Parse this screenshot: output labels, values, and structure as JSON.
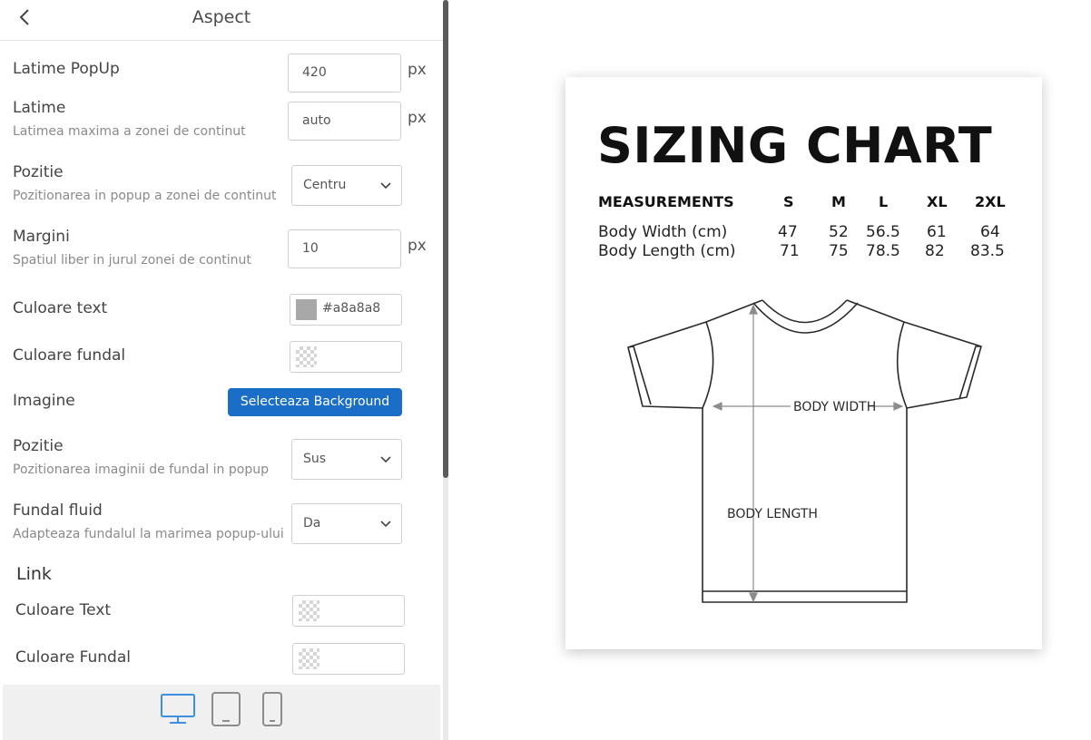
{
  "panel": {
    "title": "Aspect",
    "back_icon": "chevron-left-icon",
    "fields": {
      "popup_width": {
        "label": "Latime PopUp",
        "value": "420",
        "unit": "px"
      },
      "width": {
        "label": "Latime",
        "sublabel": "Latimea maxima a zonei de continut",
        "value": "auto",
        "unit": "px"
      },
      "position": {
        "label": "Pozitie",
        "sublabel": "Pozitionarea in popup a zonei de continut",
        "value": "Centru"
      },
      "margins": {
        "label": "Margini",
        "sublabel": "Spatiul liber in jurul zonei de continut",
        "value": "10",
        "unit": "px"
      },
      "text_color": {
        "label": "Culoare text",
        "value": "#a8a8a8"
      },
      "bg_color": {
        "label": "Culoare fundal"
      },
      "image": {
        "label": "Imagine",
        "button": "Selecteaza Background"
      },
      "image_position": {
        "label": "Pozitie",
        "sublabel": "Pozitionarea imaginii de fundal in popup",
        "value": "Sus"
      },
      "fluid_bg": {
        "label": "Fundal fluid",
        "sublabel": "Adapteaza fundalul la marimea popup-ului",
        "value": "Da"
      }
    },
    "link_section": {
      "title": "Link",
      "text_color": {
        "label": "Culoare Text"
      },
      "bg_color": {
        "label": "Culoare Fundal"
      }
    },
    "devices": [
      "desktop-icon",
      "tablet-icon",
      "mobile-icon"
    ],
    "active_device": "desktop",
    "accent_color": "#1a6ec8"
  },
  "preview": {
    "title": "SIZING CHART",
    "table": {
      "header": [
        "MEASUREMENTS",
        "S",
        "M",
        "L",
        "XL",
        "2XL"
      ],
      "rows": [
        [
          "Body Width (cm)",
          "47",
          "52",
          "56.5",
          "61",
          "64"
        ],
        [
          "Body Length (cm)",
          "71",
          "75",
          "78.5",
          "82",
          "83.5"
        ]
      ]
    },
    "diagram": {
      "width_label": "BODY WIDTH",
      "length_label": "BODY LENGTH"
    }
  }
}
